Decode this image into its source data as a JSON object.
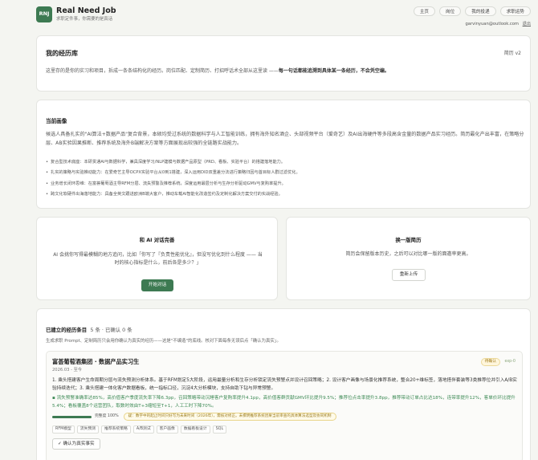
{
  "brand": {
    "logo": "RNJ",
    "name": "Real Need Job",
    "tagline": "求职定件事，你需要的是真话",
    "accent": "#3d7a52"
  },
  "nav": [
    "主页",
    "岗位",
    "我的投递",
    "求职运势"
  ],
  "user": {
    "email": "garvinyuan@outlook.com",
    "logout": "退出"
  },
  "library": {
    "title": "我的经历库",
    "version": "简历 v2",
    "desc_plain": "这里存的是你的实习和项目，拆成一条条结构化的经历。岗位匹配、定制简历、打招呼话术全部从这里读 ——",
    "desc_bold": "每一句话都能追溯到具体某一条经历，不会凭空编。"
  },
  "summary": {
    "title": "当前画像",
    "para": "候选人具备扎实的\"AI算法+数据产品\"复合背景，本硕均受过系统的数据科学与人工智能训练，拥有海外知名酒企、头部视频平台（爱奇艺）及AI出海硬件等多段高含金量的数据产品实习经历。简历最化产出丰富，在策略分层、AB实验因果推断、推荐系统及海外B端解决方案等方面展现出较强的全链路实战能力。",
    "bullets": [
      "复合型技术底座：本研贯通AI与数据科学，兼具深度学习/NLP建模与数据产品原型（PRD、看板、实验平台）的搭建落地能力。",
      "扎实的策略与实验推动能力：在爱奇艺主导OCPX实验平台从0到1搭建，深入运用DID双重差分法进行策略归因与首目标人群过滤优化。",
      "业务增长闭环思维：在富荟葡萄酒主导RFM分层、流失预警及推荐系统，深度运用最层分析与生存分析驱动GMV与复购率提升。",
      "跨文化软硬件出海落地能力：具备全英文跟进欧洲B端大客户，推动车载AI智能化改造签约及定制化解决方案交付的实战经验。"
    ]
  },
  "chat": {
    "title": "和 AI 对话完善",
    "desc": "AI 会挑你写得最模糊的地方追问，比如「你写了『负责性能优化』，但没写优化到什么程度 —— 当时的核心指标是什么，前后各是多少？」",
    "button": "开始对话"
  },
  "reupload": {
    "title": "换一版简历",
    "desc": "简历会保留版本历史，之后可以对比哪一版的面邀率更高。",
    "button": "重新上传"
  },
  "entries_section": {
    "title": "已建立的经历条目",
    "counts": "5 条 · 已确认 0 条",
    "hint": "生成求职 Prompt、定制简历只会用你确认为真实的经历——这是\"不编造\"的底线。核对下面每条无误后点「确认为真实」。"
  },
  "entry": {
    "title": "富荟葡萄酒集团 · 数据产品实习生",
    "date": "2026.03 - 至今",
    "status": "待确认",
    "id": "exp-0",
    "body": "1. 乘头搭建客户生命周期分层与流失预测分析体系。基于RFM划定5大阶段，运用最量分析和生存分析锁定流失预警点并设计召回策略；2. 设计客户画像与场景化推荐系统，整合20+维标签，落地搭伴套装等3类推荐位并引入A/B实验持续迭代；3. 乘头搭建一体化客户数据看板，统一指标口径，沉淀4大分析模块，支持自助下钻与异常预警。",
    "highlight": "流失预警准确率达85%，高价值客户季度流失率下降6.3pp，召回策略带动沉睡客户复购率提升4.1pp，高价值客群贡献GMV环比提升9.5%；推荐位点击率提升3.8pp，推荐带动订单占比达18%，连带率提升12%，客单价环比提升5.4%；看板覆盖8个运营团队，取数时效由T+3缩短至T+1，人工工时下降70%。",
    "completeness_label": "完整度 100%",
    "completeness_value": 100,
    "warning": "疑：数字中的起止时间只好写为未来时间（2026年），需核对修正。未撰明推荐系统因果当前审查的具体算法选型及协同机制",
    "tags": [
      "RFM模型",
      "流失预测",
      "推荐系统策略",
      "A/B测试",
      "客户画像",
      "数据看板设计",
      "SQL"
    ],
    "confirm_button": "✓ 确认为真实事实"
  }
}
